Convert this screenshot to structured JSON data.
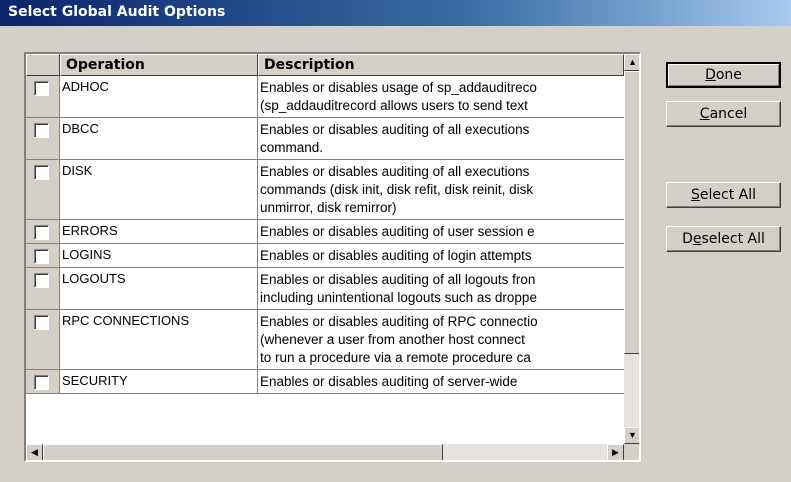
{
  "window": {
    "title": "Select Global Audit Options"
  },
  "table": {
    "columns": [
      "",
      "Operation",
      "Description"
    ],
    "rows": [
      {
        "op": "ADHOC",
        "desc": [
          "Enables or disables usage of sp_addauditreco",
          "(sp_addauditrecord allows users to send text"
        ]
      },
      {
        "op": "DBCC",
        "desc": [
          "Enables or disables auditing of all executions",
          "command."
        ]
      },
      {
        "op": "DISK",
        "desc": [
          "Enables or disables auditing of all executions",
          "commands (disk init, disk refit, disk reinit, disk",
          "unmirror, disk remirror)"
        ]
      },
      {
        "op": "ERRORS",
        "desc": [
          "Enables or disables auditing of user session e"
        ]
      },
      {
        "op": "LOGINS",
        "desc": [
          "Enables or disables auditing of login attempts"
        ]
      },
      {
        "op": "LOGOUTS",
        "desc": [
          "Enables or disables auditing of all logouts fron",
          "including unintentional logouts such as droppe"
        ]
      },
      {
        "op": "RPC CONNECTIONS",
        "desc": [
          "Enables or disables auditing of RPC connectio",
          "(whenever a user from another host connect",
          "to run a procedure via a remote procedure ca"
        ]
      },
      {
        "op": "SECURITY",
        "desc": [
          "Enables or disables auditing of server-wide"
        ]
      }
    ]
  },
  "buttons": {
    "done": {
      "accel": "D",
      "rest": "one"
    },
    "cancel": {
      "accel": "C",
      "rest": "ancel"
    },
    "select_all": {
      "accel": "S",
      "rest": "elect All"
    },
    "deselect_all": {
      "pre": "D",
      "accel": "e",
      "rest": "select All"
    }
  },
  "icons": {
    "scroll_up": "▲",
    "scroll_down": "▼",
    "scroll_left": "◀",
    "scroll_right": "▶"
  }
}
